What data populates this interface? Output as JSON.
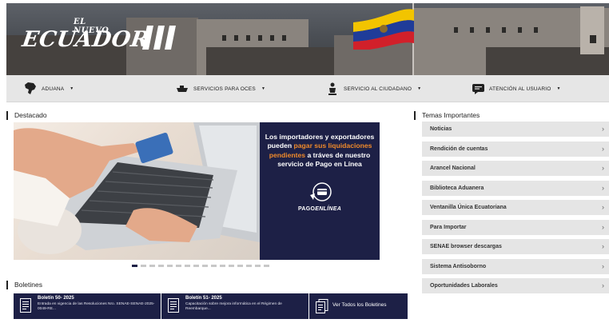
{
  "header": {
    "logo_small": "EL NUEVO",
    "logo_big": "ECUADOR",
    "colors": {
      "flag_yellow": "#f2c400",
      "flag_blue": "#1f3c99",
      "flag_red": "#d1202a"
    }
  },
  "nav": {
    "items": [
      {
        "label": "ADUANA",
        "icon": "ecuador-map-icon"
      },
      {
        "label": "SERVICIOS PARA OCES",
        "icon": "ship-icon"
      },
      {
        "label": "SERVICIO AL CIUDADANO",
        "icon": "citizen-icon"
      },
      {
        "label": "ATENCIÓN AL USUARIO",
        "icon": "chat-icon"
      }
    ]
  },
  "destacado": {
    "title": "Destacado",
    "slide": {
      "line_pre": "Los importadores y exportadores pueden ",
      "line_highlight": "pagar sus liquidaciones pendientes",
      "line_post": " a tráves de nuestro servicio de Pago en Línea",
      "logo_a": "PAGO",
      "logo_b": "ENLÍNEA"
    },
    "slide_count": 16,
    "active_slide": 1
  },
  "temas": {
    "title": "Temas Importantes",
    "items": [
      "Noticias",
      "Rendición de cuentas",
      "Arancel Nacional",
      "Biblioteca Aduanera",
      "Ventanilla Única Ecuatoriana",
      "Para Importar",
      "SENAE browser descargas",
      "Sistema Antisoborno",
      "Oportunidades Laborales"
    ],
    "chevron": "›"
  },
  "boletines": {
    "title": "Boletines",
    "items": [
      {
        "title": "Boletín 50- 2025",
        "desc": "Entrada en vigencia de las Resoluciones Nro. SENAE-SENAE-2025-0049-RE..."
      },
      {
        "title": "Boletín 51- 2025",
        "desc": "Capacitación sobre mejora informática en el Régimen de Reembarque..."
      }
    ],
    "all_label": "Ver Todos los Boletines"
  },
  "colors": {
    "navy": "#1d2046",
    "accent_orange": "#f08a2a",
    "list_bg": "#e5e5e5",
    "nav_bg": "#e6e6e6"
  }
}
